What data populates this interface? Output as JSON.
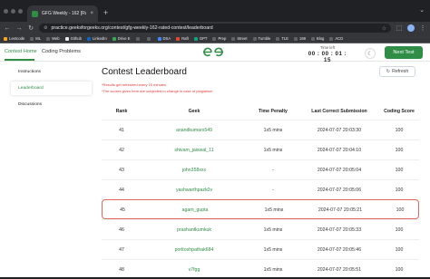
{
  "browser": {
    "tab_title": "GFG Weekly - 162 [Rated] Co...",
    "tab_close": "×",
    "new_tab": "+",
    "url": "practice.geeksforgeeks.org/contest/gfg-weekly-162-rated-contest/leaderboard",
    "bookmarks": [
      {
        "label": "Leetcode",
        "color": "#f5a623"
      },
      {
        "label": "ML",
        "color": "#5f6368"
      },
      {
        "label": "Web",
        "color": "#5f6368"
      },
      {
        "label": "Github",
        "color": "#e8eaed"
      },
      {
        "label": "LinkedIn",
        "color": "#0a66c2"
      },
      {
        "label": "Drive E",
        "color": "#34a853"
      },
      {
        "label": "",
        "color": "#5f6368"
      },
      {
        "label": "",
        "color": "#5f6368"
      },
      {
        "label": "DSA",
        "color": "#4285f4"
      },
      {
        "label": "Raft",
        "color": "#ea4335"
      },
      {
        "label": "GPT",
        "color": "#10a37f"
      },
      {
        "label": "Prep",
        "color": "#5f6368"
      },
      {
        "label": "Street",
        "color": "#5f6368"
      },
      {
        "label": "Tumble",
        "color": "#5f6368"
      },
      {
        "label": "TLE",
        "color": "#5f6368"
      },
      {
        "label": "168",
        "color": "#5f6368"
      },
      {
        "label": "Blog",
        "color": "#5f6368"
      },
      {
        "label": "ACD",
        "color": "#5f6368"
      }
    ]
  },
  "topnav": {
    "contest_home": "Contest Home",
    "coding_problems": "Coding Problems",
    "timer_label": "Time left",
    "timer_value": "00 : 00 : 01 : 15",
    "next_test": "Next Test"
  },
  "sidebar": {
    "items": [
      {
        "label": "Instructions",
        "active": false
      },
      {
        "label": "Leaderboard",
        "active": true
      },
      {
        "label": "Discussions",
        "active": false
      }
    ]
  },
  "main": {
    "title": "Contest Leaderboard",
    "refresh_label": "Refresh",
    "note_1": "*Results get refreshed every 10 minutes",
    "note_2": "*The scores given here are subjected to change in case of plagiarism",
    "columns": [
      "Rank",
      "Geek",
      "Time Penalty",
      "Last Correct Submission",
      "Coding Score"
    ],
    "rows": [
      {
        "rank": "41",
        "geek": "anandkumars549",
        "time": "1x5 mins",
        "submission": "2024-07-07 20:03:30",
        "score": "100",
        "highlight": false
      },
      {
        "rank": "42",
        "geek": "shivam_jaiswal_11",
        "time": "1x5 mins",
        "submission": "2024-07-07 20:04:10",
        "score": "100",
        "highlight": false
      },
      {
        "rank": "43",
        "geek": "john358xxx",
        "time": "-",
        "submission": "2024-07-07 20:05:04",
        "score": "100",
        "highlight": false
      },
      {
        "rank": "44",
        "geek": "yashwarthpazk0v",
        "time": "-",
        "submission": "2024-07-07 20:05:06",
        "score": "100",
        "highlight": false
      },
      {
        "rank": "45",
        "geek": "agam_gupta",
        "time": "1x5 mins",
        "submission": "2024-07-07 20:05:21",
        "score": "100",
        "highlight": true
      },
      {
        "rank": "46",
        "geek": "prashantkumkuk",
        "time": "1x5 mins",
        "submission": "2024-07-07 20:05:33",
        "score": "100",
        "highlight": false
      },
      {
        "rank": "47",
        "geek": "porltoshpathak684",
        "time": "1x5 mins",
        "submission": "2024-07-07 20:05:46",
        "score": "100",
        "highlight": false
      },
      {
        "rank": "48",
        "geek": "v7fgg",
        "time": "1x5 mins",
        "submission": "2024-07-07 20:05:51",
        "score": "100",
        "highlight": false
      }
    ]
  },
  "colors": {
    "brand_green": "#2f8d46",
    "highlight_border": "#e0665e",
    "note_red": "#e53935"
  }
}
